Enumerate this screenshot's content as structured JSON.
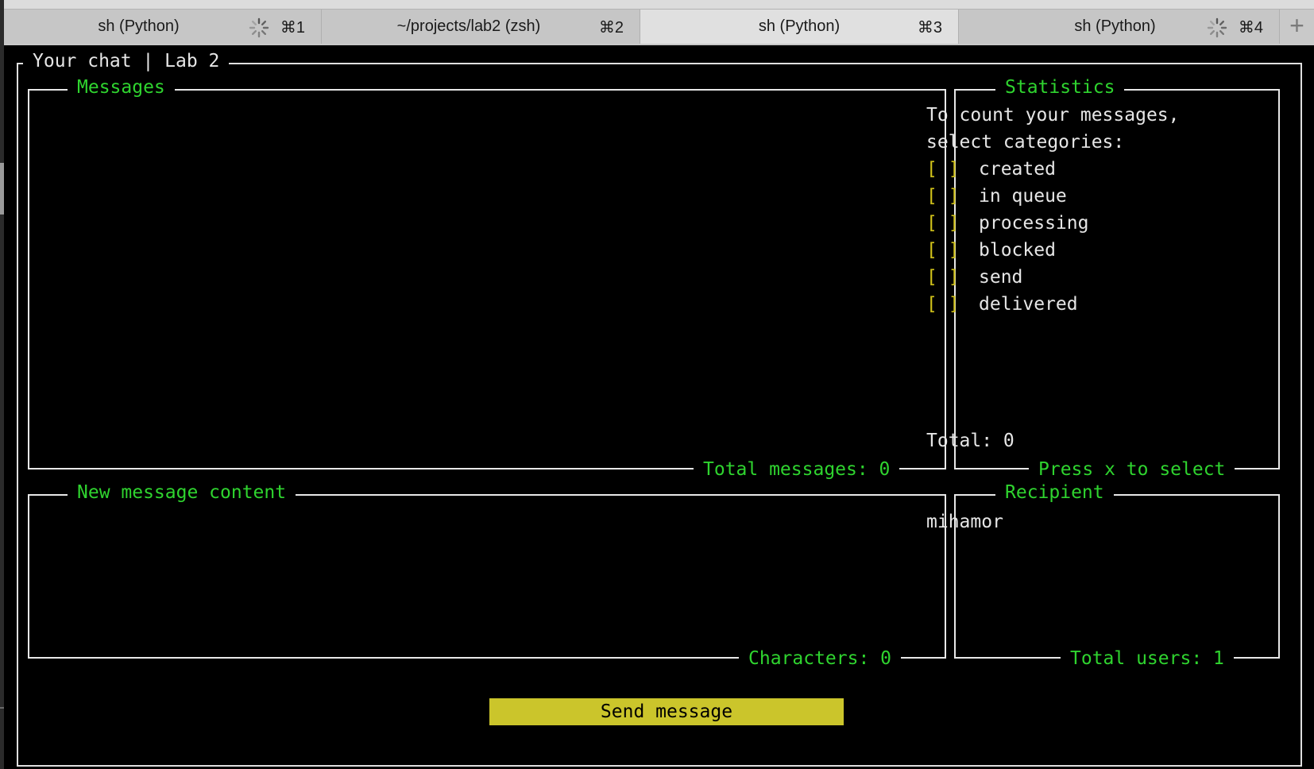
{
  "tabs": [
    {
      "title": "sh (Python)",
      "shortcut": "⌘1",
      "busy": true,
      "active": false
    },
    {
      "title": "~/projects/lab2 (zsh)",
      "shortcut": "⌘2",
      "busy": false,
      "active": false
    },
    {
      "title": "sh (Python)",
      "shortcut": "⌘3",
      "busy": false,
      "active": true
    },
    {
      "title": "sh (Python)",
      "shortcut": "⌘4",
      "busy": true,
      "active": false
    }
  ],
  "add_tab_label": "+",
  "window": {
    "title": "Your chat | Lab 2"
  },
  "messages_panel": {
    "title": "Messages",
    "footer": "Total messages: 0"
  },
  "statistics_panel": {
    "title": "Statistics",
    "intro_line1": "To count your messages,",
    "intro_line2": "select categories:",
    "checkbox": "[ ]",
    "categories": [
      "created",
      "in queue",
      "processing",
      "blocked",
      "send",
      "delivered"
    ],
    "total": "Total: 0",
    "footer": "Press x to select"
  },
  "new_message_panel": {
    "title": "New message content",
    "value": "",
    "footer": "Characters: 0"
  },
  "recipient_panel": {
    "title": "Recipient",
    "value": "mihamor",
    "footer": "Total users: 1"
  },
  "send_button": {
    "label": "Send message"
  },
  "colors": {
    "accent_green": "#2fd42f",
    "checkbox_yellow": "#d1c21a",
    "button_yellow": "#cbc52b",
    "border": "#e8e8e8"
  }
}
